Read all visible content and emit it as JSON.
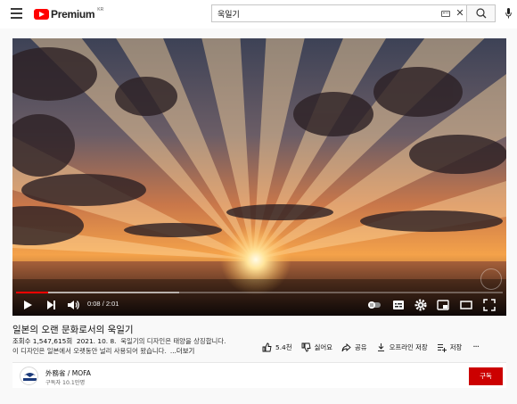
{
  "header": {
    "logo_text": "Premium",
    "region": "KR",
    "search_value": "욱일기",
    "search_placeholder": "검색"
  },
  "player": {
    "current_time": "0:08",
    "duration": "2:01",
    "time_separator": " / ",
    "played_fraction": 0.066,
    "buffered_fraction": 0.335
  },
  "video": {
    "title": "일본의 오랜 문화로서의 욱일기",
    "views_label": "조회수 1,547,615회",
    "date": "2021. 10. 8.",
    "desc_line1": "욱일기의 디자인은 태양을 상징합니다.",
    "desc_line2": "이 디자인은 일본에서 오랫동안 널리 사용되어 왔습니다.",
    "more_label": "...더보기"
  },
  "actions": {
    "like_count": "5.4천",
    "dislike_label": "싫어요",
    "share_label": "공유",
    "download_label": "오프라인 저장",
    "save_label": "저장"
  },
  "channel": {
    "name": "外務省 / MOFA",
    "subscribers": "구독자 10.1만명",
    "subscribe_label": "구독"
  },
  "colors": {
    "brand_red": "#ff0000",
    "subscribe_red": "#cc0000"
  }
}
